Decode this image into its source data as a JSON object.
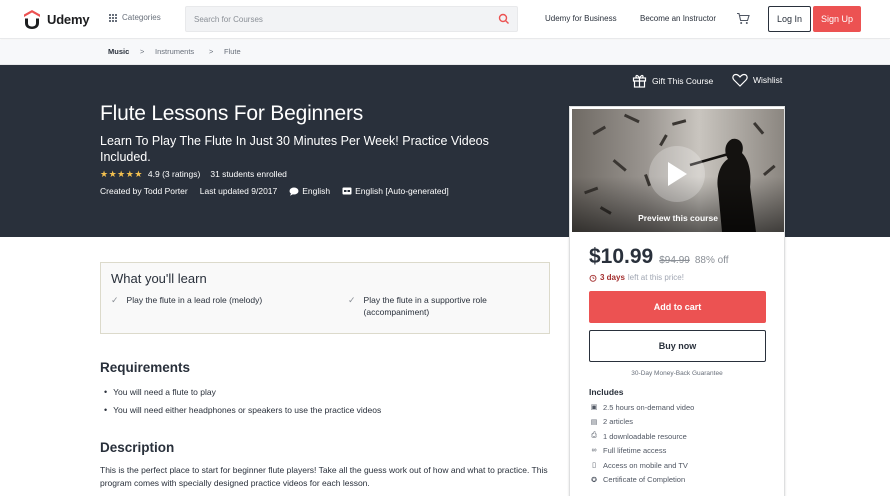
{
  "nav": {
    "logo_text": "Udemy",
    "categories_label": "Categories",
    "search_placeholder": "Search for Courses",
    "business_link": "Udemy for Business",
    "instructor_link": "Become an Instructor",
    "login_label": "Log In",
    "signup_label": "Sign Up",
    "brand_color": "#ec5252"
  },
  "breadcrumb": [
    "Music",
    "Instruments",
    "Flute"
  ],
  "breadcrumb_sep": ">",
  "hero": {
    "gift_label": "Gift This Course",
    "wishlist_label": "Wishlist",
    "title": "Flute Lessons For Beginners",
    "subtitle": "Learn To Play The Flute In Just 30 Minutes Per Week! Practice Videos Included.",
    "rating_text": "4.9 (3 ratings)",
    "rating_value": 4.9,
    "enrolled_text": "31 students enrolled",
    "author": "Created by Todd Porter",
    "updated": "Last updated 9/2017",
    "language": "English",
    "captions": "English [Auto-generated]"
  },
  "card": {
    "preview_label": "Preview this course",
    "price": "$10.99",
    "original_price": "$94.99",
    "discount": "88% off",
    "timer_bold": "3 days",
    "timer_rest": "left at this price!",
    "add_to_cart": "Add to cart",
    "buy_now": "Buy now",
    "guarantee": "30-Day Money-Back Guarantee",
    "includes_title": "Includes",
    "includes": [
      {
        "icon": "video-icon",
        "text": "2.5 hours on-demand video"
      },
      {
        "icon": "article-icon",
        "text": "2 articles"
      },
      {
        "icon": "download-icon",
        "text": "1 downloadable resource"
      },
      {
        "icon": "infinity-icon",
        "text": "Full lifetime access"
      },
      {
        "icon": "mobile-icon",
        "text": "Access on mobile and TV"
      },
      {
        "icon": "certificate-icon",
        "text": "Certificate of Completion"
      }
    ]
  },
  "learn": {
    "title": "What you'll learn",
    "items": [
      "Play the flute in a lead role (melody)",
      "Play the flute in a supportive role (accompaniment)"
    ]
  },
  "requirements": {
    "title": "Requirements",
    "items": [
      "You will need a flute to play",
      "You will need either headphones or speakers to use the practice videos"
    ]
  },
  "description": {
    "title": "Description",
    "text": "This is the perfect place to start for beginner flute players! Take all the guess work out of how and what to practice. This program comes with specially designed practice videos for each lesson."
  }
}
